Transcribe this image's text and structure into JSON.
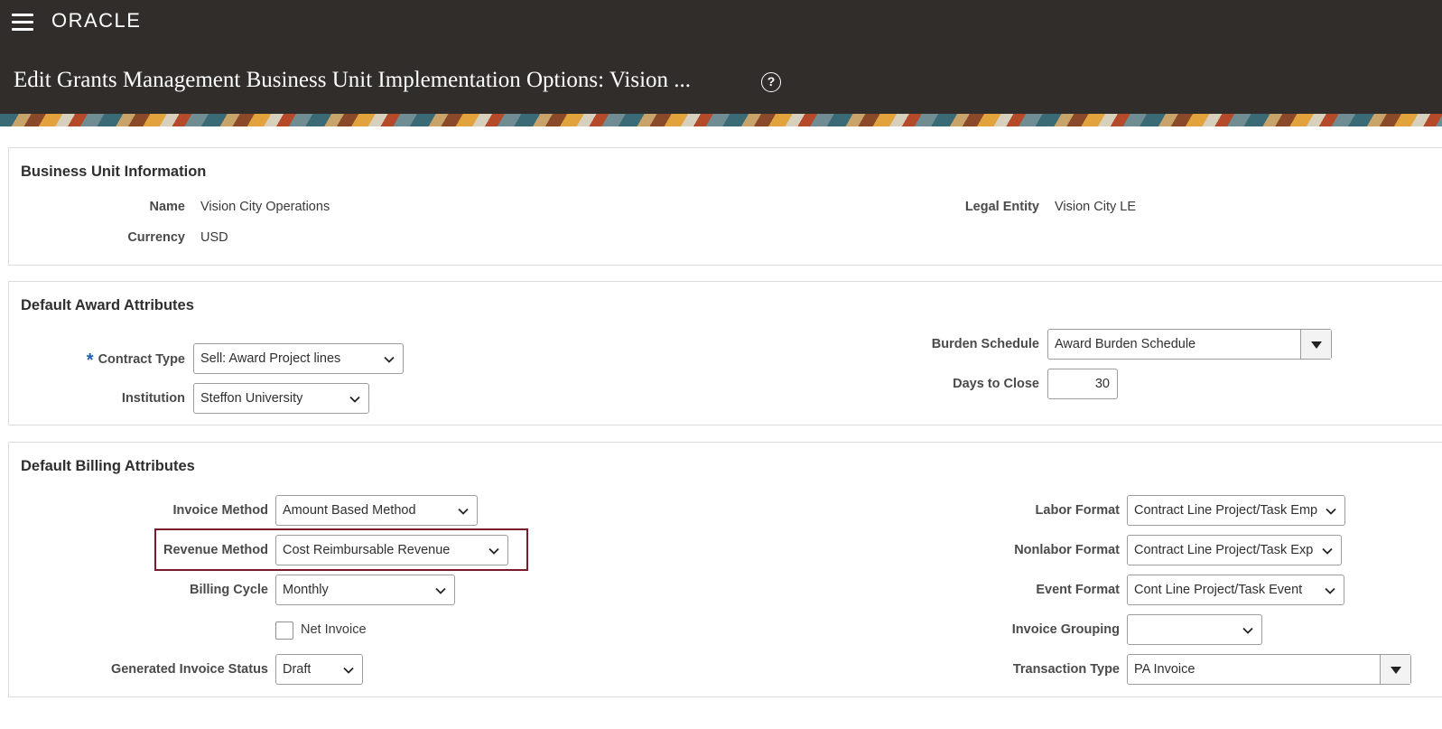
{
  "header": {
    "brand": "ORACLE",
    "title": "Edit Grants Management Business Unit Implementation Options: Vision ...",
    "help_symbol": "?"
  },
  "business_unit": {
    "title": "Business Unit Information",
    "name_label": "Name",
    "name_value": "Vision City Operations",
    "currency_label": "Currency",
    "currency_value": "USD",
    "legal_entity_label": "Legal Entity",
    "legal_entity_value": "Vision City LE"
  },
  "award": {
    "title": "Default Award Attributes",
    "required_marker": "*",
    "contract_type_label": "Contract Type",
    "contract_type_value": "Sell: Award Project lines",
    "institution_label": "Institution",
    "institution_value": "Steffon University",
    "burden_schedule_label": "Burden Schedule",
    "burden_schedule_value": "Award Burden Schedule",
    "days_to_close_label": "Days to Close",
    "days_to_close_value": "30"
  },
  "billing": {
    "title": "Default Billing Attributes",
    "invoice_method_label": "Invoice Method",
    "invoice_method_value": "Amount Based Method",
    "revenue_method_label": "Revenue Method",
    "revenue_method_value": "Cost Reimbursable Revenue",
    "billing_cycle_label": "Billing Cycle",
    "billing_cycle_value": "Monthly",
    "net_invoice_label": "Net Invoice",
    "net_invoice_checked": false,
    "generated_invoice_status_label": "Generated Invoice Status",
    "generated_invoice_status_value": "Draft",
    "labor_format_label": "Labor Format",
    "labor_format_value": "Contract Line Project/Task Emp",
    "nonlabor_format_label": "Nonlabor Format",
    "nonlabor_format_value": "Contract Line Project/Task Exp",
    "event_format_label": "Event Format",
    "event_format_value": "Cont Line Project/Task Event",
    "invoice_grouping_label": "Invoice Grouping",
    "invoice_grouping_value": "",
    "transaction_type_label": "Transaction Type",
    "transaction_type_value": "PA Invoice"
  },
  "colors": {
    "header_bg": "#312d2a",
    "highlight_border": "#7a1a2b",
    "required_marker": "#1f5fb0"
  }
}
